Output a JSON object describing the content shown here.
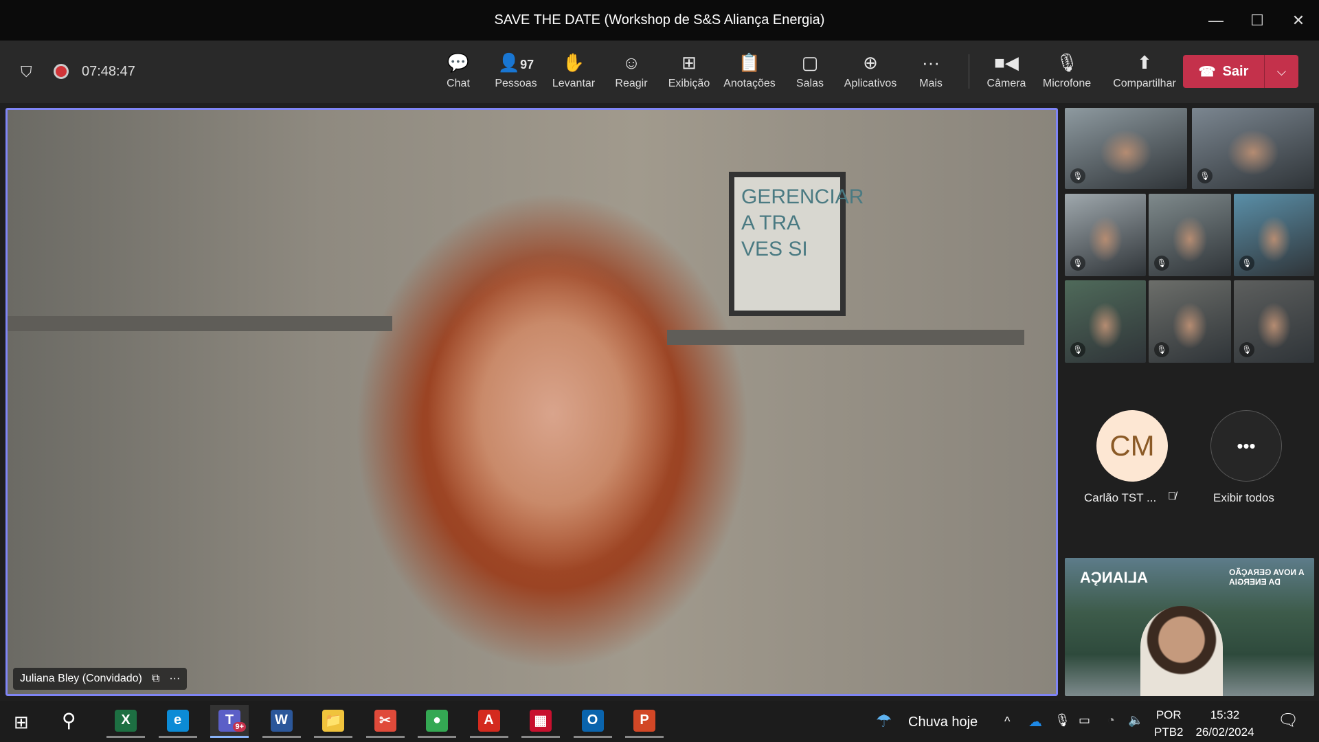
{
  "window": {
    "title": "SAVE THE DATE (Workshop de S&S Aliança Energia)",
    "minimize": "—",
    "maximize": "☐",
    "close": "✕"
  },
  "toolbar": {
    "timer": "07:48:47",
    "people_count": "97",
    "buttons": [
      {
        "label": "Chat",
        "icon": "chat-icon",
        "glyph": "💬"
      },
      {
        "label": "Pessoas",
        "icon": "people-icon",
        "glyph": "👤"
      },
      {
        "label": "Levantar",
        "icon": "hand-icon",
        "glyph": "✋"
      },
      {
        "label": "Reagir",
        "icon": "smiley-icon",
        "glyph": "☺"
      },
      {
        "label": "Exibição",
        "icon": "grid-icon",
        "glyph": "⊞"
      },
      {
        "label": "Anotações",
        "icon": "notes-icon",
        "glyph": "📋"
      },
      {
        "label": "Salas",
        "icon": "rooms-icon",
        "glyph": "▢"
      },
      {
        "label": "Aplicativos",
        "icon": "apps-icon",
        "glyph": "⊕"
      },
      {
        "label": "Mais",
        "icon": "more-icon",
        "glyph": "···"
      }
    ],
    "media": [
      {
        "label": "Câmera",
        "icon": "camera-icon",
        "glyph": "■◀"
      },
      {
        "label": "Microfone",
        "icon": "mic-off-icon",
        "glyph": "🎙"
      },
      {
        "label": "Compartilhar",
        "icon": "share-icon",
        "glyph": "⬆"
      }
    ],
    "leave_label": "Sair",
    "accent_leave": "#c4314b"
  },
  "main": {
    "speaker_name": "Juliana Bley (Convidado)",
    "poster_text": "GERENCIAR A TRA VES SI",
    "highlight": "#7f85f5"
  },
  "participants": {
    "avatar_initials": "CM",
    "avatar_name": "Carlão TST ...",
    "show_all": "Exibir todos"
  },
  "share": {
    "brand": "ALIANÇA",
    "tagline": "A NOVA GERAÇÃO DA ENERGIA"
  },
  "taskbar": {
    "weather": "Chuva hoje",
    "lang1": "POR",
    "lang2": "PTB2",
    "time": "15:32",
    "date": "26/02/2024",
    "apps": [
      {
        "name": "excel",
        "glyph": "X",
        "color": "#1d6f42"
      },
      {
        "name": "edge",
        "glyph": "e",
        "color": "#0c8bd6"
      },
      {
        "name": "teams",
        "glyph": "T",
        "color": "#5b5fc7"
      },
      {
        "name": "word",
        "glyph": "W",
        "color": "#2b579a"
      },
      {
        "name": "explorer",
        "glyph": "📁",
        "color": "#f0c33c"
      },
      {
        "name": "snipping",
        "glyph": "✂",
        "color": "#e04a3a"
      },
      {
        "name": "chrome",
        "glyph": "●",
        "color": "#34a853"
      },
      {
        "name": "acrobat",
        "glyph": "A",
        "color": "#d42a1e"
      },
      {
        "name": "security",
        "glyph": "▦",
        "color": "#c8102e"
      },
      {
        "name": "outlook",
        "glyph": "O",
        "color": "#0a64ad"
      },
      {
        "name": "powerpoint",
        "glyph": "P",
        "color": "#d24726"
      }
    ],
    "teams_badge": "9+"
  }
}
